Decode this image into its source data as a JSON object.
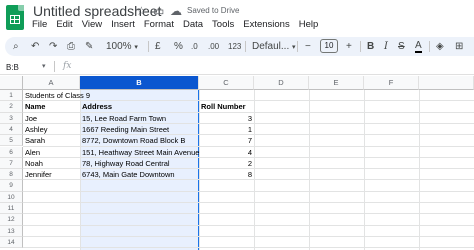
{
  "document": {
    "title": "Untitled spreadsheet",
    "saved_status": "Saved to Drive"
  },
  "menu": [
    "File",
    "Edit",
    "View",
    "Insert",
    "Format",
    "Data",
    "Tools",
    "Extensions",
    "Help"
  ],
  "toolbar": {
    "zoom": "100%",
    "currency": "£",
    "percent": "%",
    "decrease_decimal": ".0",
    "increase_decimal": ".00",
    "number_format": "123",
    "font": "Defaul...",
    "font_size": "10"
  },
  "formula_bar": {
    "name_box": "B:B",
    "fx_label": "fx",
    "content": ""
  },
  "columns": [
    "A",
    "B",
    "C",
    "D",
    "E",
    "F"
  ],
  "rows": [
    "1",
    "2",
    "3",
    "4",
    "5",
    "6",
    "7",
    "8",
    "9",
    "10",
    "11",
    "12",
    "13",
    "14"
  ],
  "cells": {
    "title": "Students of Class 9",
    "headers": [
      "Name",
      "Address",
      "Roll Number"
    ],
    "students": [
      {
        "name": "Joe",
        "address": "15, Lee Road Farm Town",
        "roll": "3"
      },
      {
        "name": "Ashley",
        "address": "1667 Reeding Main Street",
        "roll": "1"
      },
      {
        "name": "Sarah",
        "address": "8772, Downtown Road Block B",
        "roll": "7"
      },
      {
        "name": "Alen",
        "address": "151, Heathway Street Main Avenue",
        "roll": "4"
      },
      {
        "name": "Noah",
        "address": "78, Highway Road Central",
        "roll": "2"
      },
      {
        "name": "Jennifer",
        "address": "6743, Main Gate Downtown",
        "roll": "8"
      }
    ]
  },
  "colors": {
    "accent": "#0b57d0",
    "selection_fill": "#e8f0fe",
    "toolbar_bg": "#edf2fa",
    "logo": "#0f9d58"
  }
}
